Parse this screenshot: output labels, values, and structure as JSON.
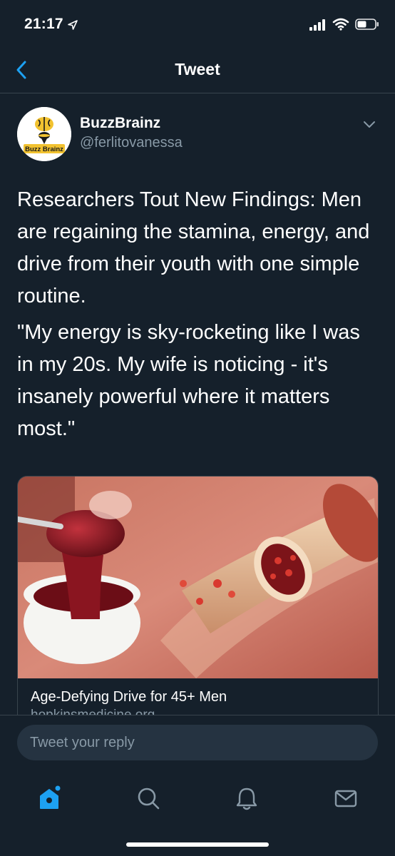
{
  "status_bar": {
    "time": "21:17",
    "icons": [
      "location-arrow-icon",
      "signal-icon",
      "wifi-icon",
      "battery-icon"
    ]
  },
  "nav": {
    "title": "Tweet",
    "back_icon": "chevron-left-icon"
  },
  "tweet": {
    "author_name": "BuzzBrainz",
    "author_handle": "@ferlitovanessa",
    "avatar_logo_text": "Buzz Brainz",
    "paragraphs": [
      "Researchers Tout New Findings: Men are regaining the stamina, energy, and drive from their youth with one simple routine.",
      "\"My energy is sky-rocketing like I was in my 20s. My wife is noticing - it's insanely powerful where it matters most.\""
    ],
    "menu_icon": "chevron-down-icon"
  },
  "card": {
    "title": "Age-Defying Drive for 45+ Men",
    "domain": "hopkinsmedicine.org"
  },
  "reply": {
    "placeholder": "Tweet your reply"
  },
  "tabs": [
    {
      "name": "home",
      "icon": "home-icon",
      "active": true
    },
    {
      "name": "search",
      "icon": "search-icon",
      "active": false
    },
    {
      "name": "notifications",
      "icon": "bell-icon",
      "active": false
    },
    {
      "name": "messages",
      "icon": "mail-icon",
      "active": false
    }
  ],
  "colors": {
    "background": "#15202b",
    "accent": "#1da1f2",
    "secondary_text": "#8899a6",
    "divider": "#38444d"
  }
}
